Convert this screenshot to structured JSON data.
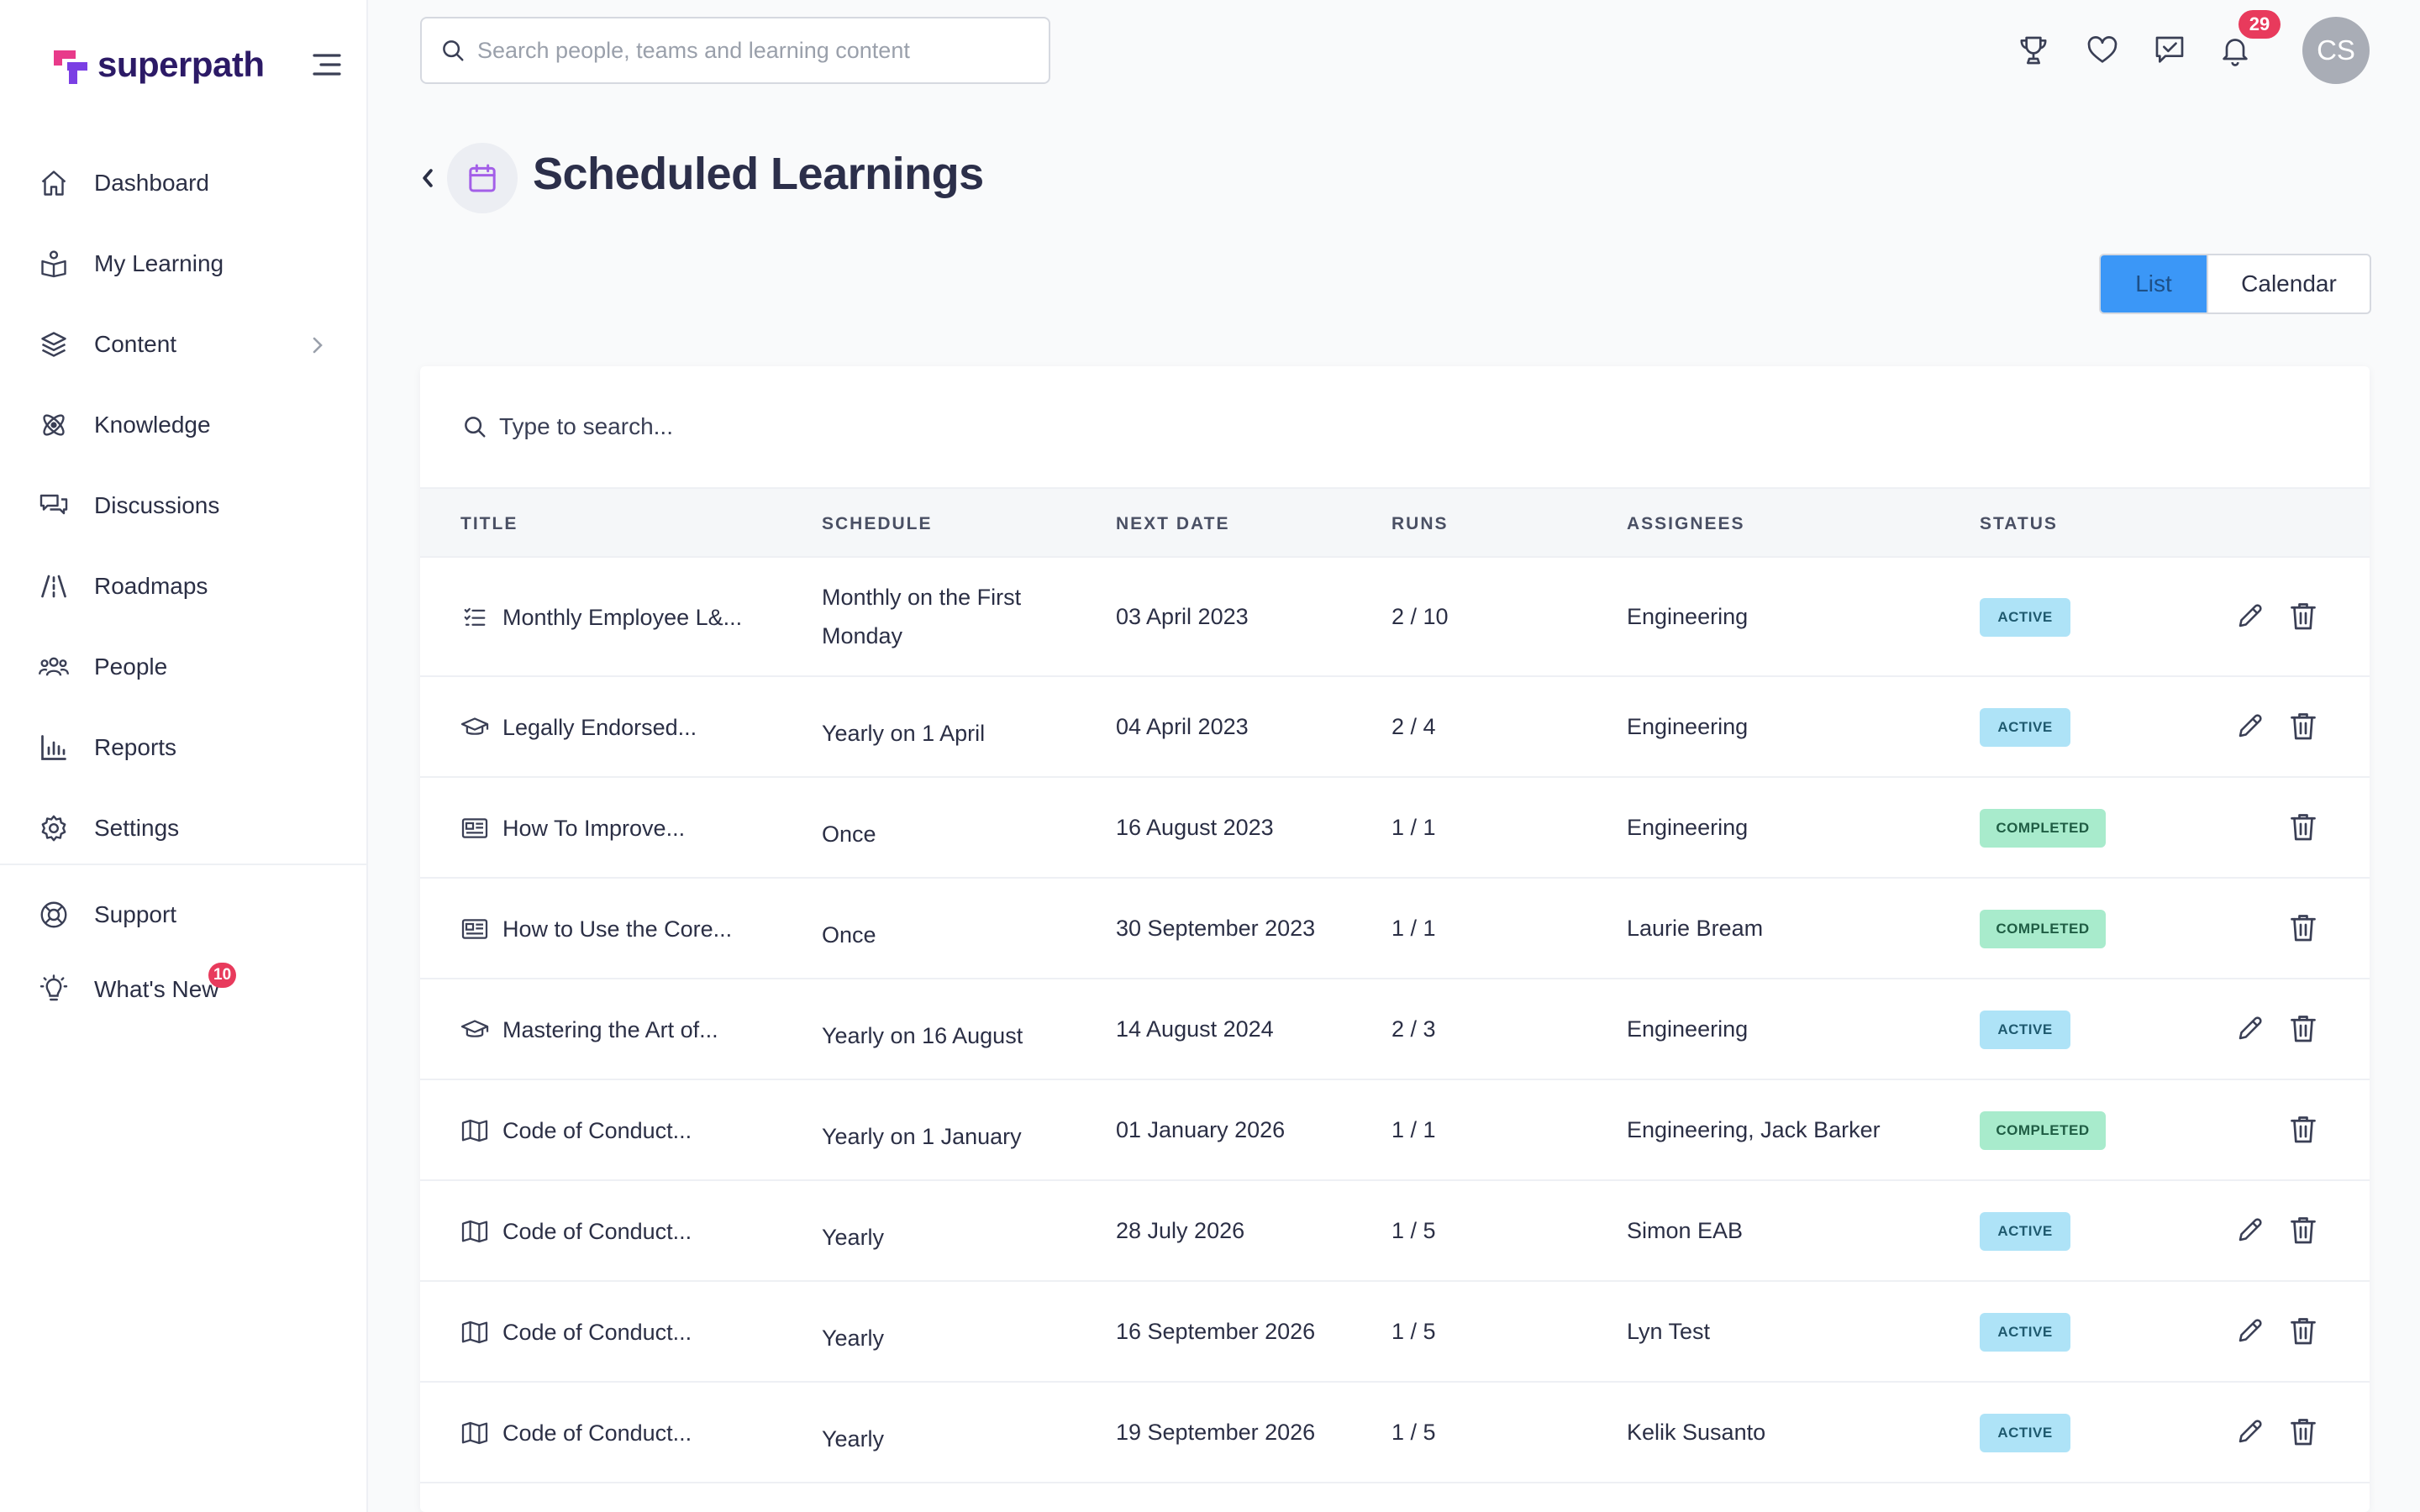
{
  "brand": {
    "name": "superpath",
    "accent": "#3b97f7",
    "logo_colors": [
      "#e83a8a",
      "#7b3fe4"
    ]
  },
  "sidebar": {
    "items": [
      {
        "label": "Dashboard",
        "icon": "home-icon"
      },
      {
        "label": "My Learning",
        "icon": "book-user-icon"
      },
      {
        "label": "Content",
        "icon": "layers-icon",
        "has_submenu": true
      },
      {
        "label": "Knowledge",
        "icon": "atom-icon"
      },
      {
        "label": "Discussions",
        "icon": "chat-icon"
      },
      {
        "label": "Roadmaps",
        "icon": "road-icon"
      },
      {
        "label": "People",
        "icon": "people-icon"
      },
      {
        "label": "Reports",
        "icon": "bar-chart-icon"
      },
      {
        "label": "Settings",
        "icon": "gear-icon"
      }
    ],
    "secondary": [
      {
        "label": "Support",
        "icon": "lifebuoy-icon"
      },
      {
        "label": "What's New",
        "icon": "lightbulb-icon",
        "badge": "10"
      }
    ]
  },
  "topbar": {
    "search_placeholder": "Search people, teams and learning content",
    "notifications_count": "29",
    "avatar_initials": "CS"
  },
  "page": {
    "title": "Scheduled Learnings",
    "view_toggle": {
      "list": "List",
      "calendar": "Calendar",
      "selected": "List"
    }
  },
  "table": {
    "search_placeholder": "Type to search...",
    "columns": [
      "TITLE",
      "SCHEDULE",
      "NEXT DATE",
      "RUNS",
      "ASSIGNEES",
      "STATUS"
    ],
    "rows": [
      {
        "icon": "checklist-icon",
        "title": "Monthly Employee L&...",
        "schedule": "Monthly on the First Monday",
        "next_date": "03 April 2023",
        "runs": "2 / 10",
        "assignees": "Engineering",
        "status": "ACTIVE",
        "editable": true
      },
      {
        "icon": "graduation-cap-icon",
        "title": "Legally Endorsed...",
        "schedule": "Yearly on 1 April",
        "next_date": "04 April 2023",
        "runs": "2 / 4",
        "assignees": "Engineering",
        "status": "ACTIVE",
        "editable": true
      },
      {
        "icon": "article-icon",
        "title": "How To Improve...",
        "schedule": "Once",
        "next_date": "16 August 2023",
        "runs": "1 / 1",
        "assignees": "Engineering",
        "status": "COMPLETED",
        "editable": false
      },
      {
        "icon": "article-icon",
        "title": "How to Use the Core...",
        "schedule": "Once",
        "next_date": "30 September 2023",
        "runs": "1 / 1",
        "assignees": "Laurie Bream",
        "status": "COMPLETED",
        "editable": false
      },
      {
        "icon": "graduation-cap-icon",
        "title": "Mastering the Art of...",
        "schedule": "Yearly on 16 August",
        "next_date": "14 August 2024",
        "runs": "2 / 3",
        "assignees": "Engineering",
        "status": "ACTIVE",
        "editable": true
      },
      {
        "icon": "map-icon",
        "title": "Code of Conduct...",
        "schedule": "Yearly on 1 January",
        "next_date": "01 January 2026",
        "runs": "1 / 1",
        "assignees": "Engineering, Jack Barker",
        "status": "COMPLETED",
        "editable": false
      },
      {
        "icon": "map-icon",
        "title": "Code of Conduct...",
        "schedule": "Yearly",
        "next_date": "28 July 2026",
        "runs": "1 / 5",
        "assignees": "Simon EAB",
        "status": "ACTIVE",
        "editable": true
      },
      {
        "icon": "map-icon",
        "title": "Code of Conduct...",
        "schedule": "Yearly",
        "next_date": "16 September 2026",
        "runs": "1 / 5",
        "assignees": "Lyn Test",
        "status": "ACTIVE",
        "editable": true
      },
      {
        "icon": "map-icon",
        "title": "Code of Conduct...",
        "schedule": "Yearly",
        "next_date": "19 September 2026",
        "runs": "1 / 5",
        "assignees": "Kelik Susanto",
        "status": "ACTIVE",
        "editable": true
      }
    ]
  }
}
